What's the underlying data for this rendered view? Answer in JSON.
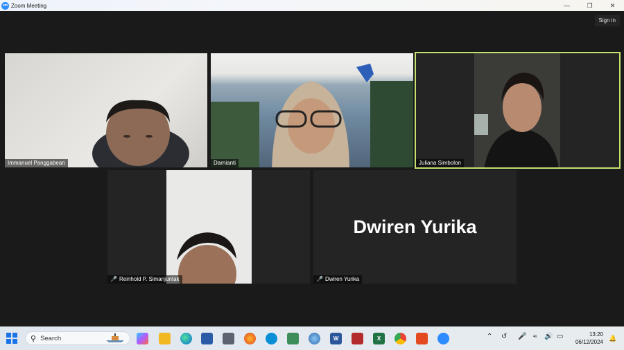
{
  "window": {
    "title": "Zoom Meeting",
    "controls": [
      "—",
      "❐",
      "✕"
    ]
  },
  "header": {
    "signin_label": "Sign in"
  },
  "participants": [
    {
      "name": "Immanuel Panggabean",
      "muted": false,
      "video": true
    },
    {
      "name": "Darnianti",
      "muted": false,
      "video": true
    },
    {
      "name": "Juliana Simbolon",
      "muted": false,
      "video": true,
      "active_speaker": true
    },
    {
      "name": "Reinhold P. Simanjuntak",
      "muted": true,
      "video": true
    },
    {
      "name": "Dwiren Yurika",
      "muted": true,
      "video": false,
      "display_name": "Dwiren Yurika"
    }
  ],
  "taskbar": {
    "search_placeholder": "Search",
    "clock_time": "13:20",
    "clock_date": "06/12/2024",
    "pinned_icons": [
      "copilot-icon",
      "file-explorer-icon",
      "edge-icon",
      "store-icon",
      "camera-icon",
      "firefox-icon",
      "teams-like-icon",
      "maps-icon",
      "globe-icon",
      "word-icon",
      "app-red-icon",
      "excel-icon",
      "chrome-icon",
      "office-icon",
      "zoom-icon"
    ]
  },
  "colors": {
    "active_border": "#c5e26f",
    "muted_icon": "#e02828",
    "background": "#1a1a1a",
    "tile": "#242424"
  }
}
